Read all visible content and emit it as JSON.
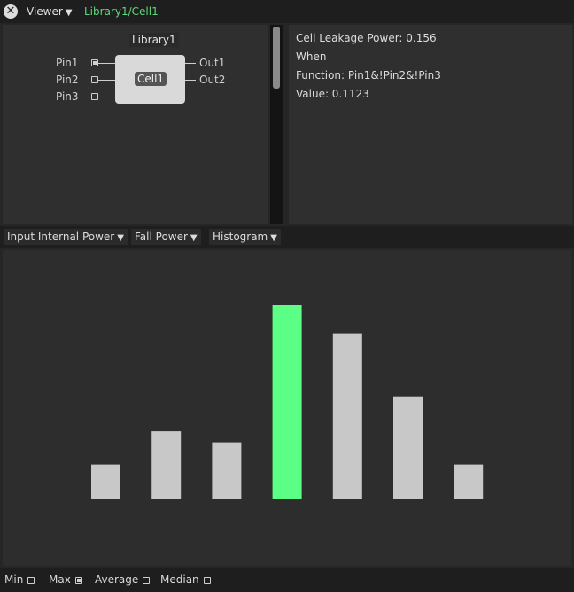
{
  "titlebar": {
    "close_glyph": "✕",
    "viewer_label": "Viewer",
    "path": "Library1/Cell1"
  },
  "schematic": {
    "library": "Library1",
    "cell": "Cell1",
    "inputs": [
      {
        "name": "Pin1",
        "checked": true
      },
      {
        "name": "Pin2",
        "checked": false
      },
      {
        "name": "Pin3",
        "checked": false
      }
    ],
    "outputs": [
      "Out1",
      "Out2"
    ]
  },
  "info": {
    "line1": "Cell Leakage Power: 0.156",
    "line2": "When",
    "line3": "Function: Pin1&!Pin2&!Pin3",
    "line4": "Value: 0.1123"
  },
  "dropdowns": {
    "power_type": "Input Internal Power",
    "transition": "Fall Power",
    "view": "Histogram"
  },
  "chart_data": {
    "type": "bar",
    "values": [
      1,
      2,
      1.65,
      5.7,
      4.85,
      3,
      1
    ],
    "highlight_index": 3,
    "ylim": [
      0,
      7
    ],
    "colors": {
      "bar": "#c8c8c8",
      "highlight": "#5cff85"
    },
    "grid": false
  },
  "footer": {
    "min": {
      "label": "Min",
      "checked": false
    },
    "max": {
      "label": "Max",
      "checked": true
    },
    "average": {
      "label": "Average",
      "checked": false
    },
    "median": {
      "label": "Median",
      "checked": false
    }
  }
}
